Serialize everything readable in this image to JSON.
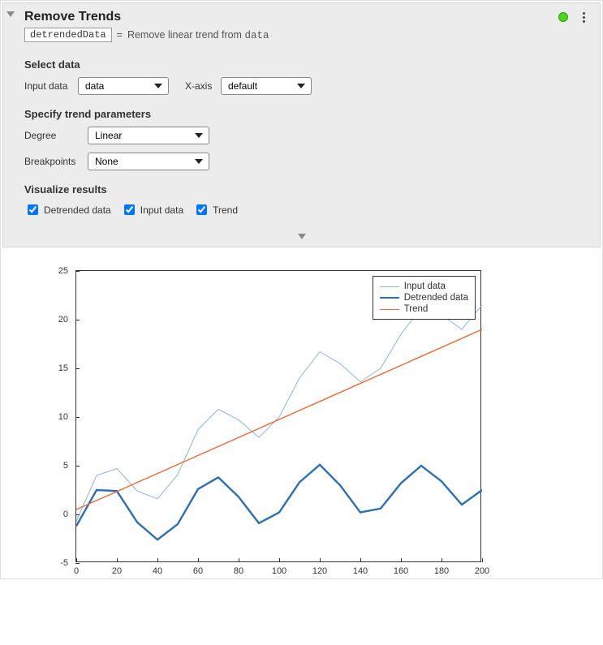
{
  "header": {
    "title": "Remove Trends",
    "output_var": "detrendedData",
    "assign_eq": "=",
    "assign_text_pre": "Remove linear trend from ",
    "assign_text_mono": "data"
  },
  "sections": {
    "select_data": {
      "heading": "Select data",
      "input_data_label": "Input data",
      "input_data_value": "data",
      "xaxis_label": "X-axis",
      "xaxis_value": "default"
    },
    "trend_params": {
      "heading": "Specify trend parameters",
      "degree_label": "Degree",
      "degree_value": "Linear",
      "breakpoints_label": "Breakpoints",
      "breakpoints_value": "None"
    },
    "visualize": {
      "heading": "Visualize results",
      "checks": [
        {
          "label": "Detrended data",
          "checked": true
        },
        {
          "label": "Input data",
          "checked": true
        },
        {
          "label": "Trend",
          "checked": true
        }
      ]
    }
  },
  "legend": {
    "input": "Input data",
    "detrended": "Detrended data",
    "trend": "Trend"
  },
  "chart_data": {
    "type": "line",
    "xlabel": "",
    "ylabel": "",
    "xlim": [
      0,
      200
    ],
    "ylim": [
      -5,
      25
    ],
    "xticks": [
      0,
      20,
      40,
      60,
      80,
      100,
      120,
      140,
      160,
      180,
      200
    ],
    "yticks": [
      -5,
      0,
      5,
      10,
      15,
      20,
      25
    ],
    "series": [
      {
        "name": "Input data",
        "x": [
          0,
          10,
          20,
          30,
          40,
          50,
          60,
          70,
          80,
          90,
          100,
          110,
          120,
          130,
          140,
          150,
          160,
          170,
          180,
          190,
          200
        ],
        "values": [
          -0.7,
          4.0,
          4.7,
          2.4,
          1.6,
          4.1,
          8.7,
          10.8,
          9.7,
          7.9,
          10.0,
          14.0,
          16.7,
          15.5,
          13.6,
          15.0,
          18.5,
          21.2,
          20.5,
          19.0,
          21.5
        ]
      },
      {
        "name": "Detrended data",
        "x": [
          0,
          10,
          20,
          30,
          40,
          50,
          60,
          70,
          80,
          90,
          100,
          110,
          120,
          130,
          140,
          150,
          160,
          170,
          180,
          190,
          200
        ],
        "values": [
          -1.2,
          2.5,
          2.4,
          -0.8,
          -2.6,
          -1.0,
          2.6,
          3.8,
          1.8,
          -0.9,
          0.2,
          3.3,
          5.1,
          3.0,
          0.2,
          0.6,
          3.2,
          5.0,
          3.4,
          1.0,
          2.5
        ]
      },
      {
        "name": "Trend",
        "x": [
          0,
          200
        ],
        "values": [
          0.5,
          19.0
        ]
      }
    ],
    "colors": {
      "Input data": "#8db6d2",
      "Detrended data": "#2d6fb0",
      "Trend": "#e86b35"
    }
  }
}
